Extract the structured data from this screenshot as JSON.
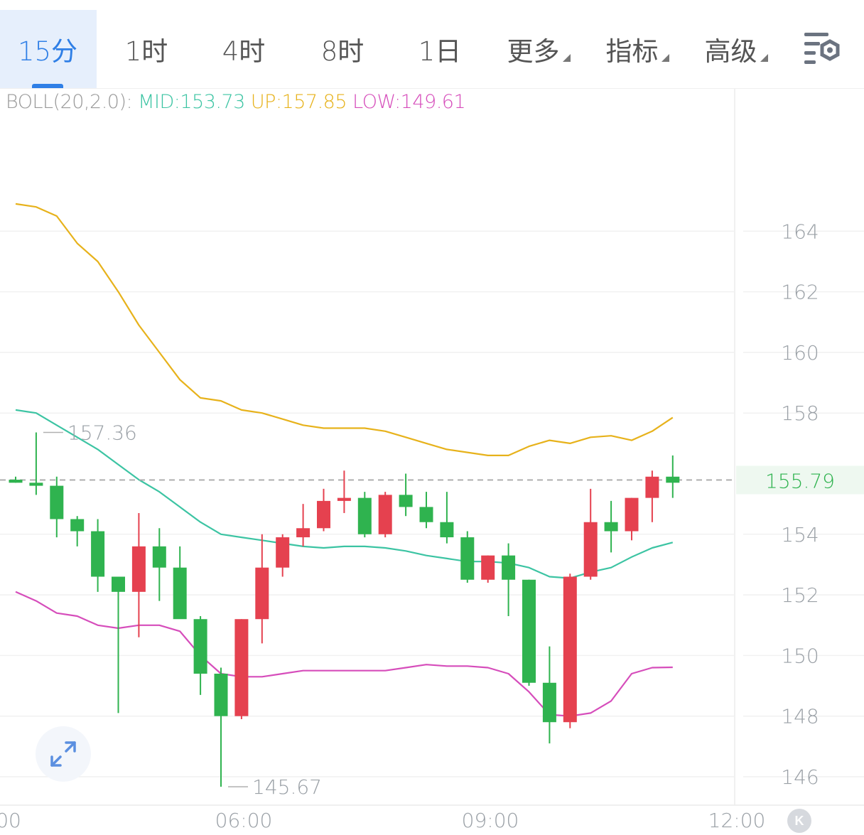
{
  "tabs": [
    {
      "label": "15分",
      "active": true,
      "has_dropdown": false
    },
    {
      "label": "1时",
      "active": false,
      "has_dropdown": false
    },
    {
      "label": "4时",
      "active": false,
      "has_dropdown": false
    },
    {
      "label": "8时",
      "active": false,
      "has_dropdown": false
    },
    {
      "label": "1日",
      "active": false,
      "has_dropdown": false
    },
    {
      "label": "更多",
      "active": false,
      "has_dropdown": true
    },
    {
      "label": "指标",
      "active": false,
      "has_dropdown": true
    },
    {
      "label": "高级",
      "active": false,
      "has_dropdown": true
    }
  ],
  "settings_icon": "chart-settings-icon",
  "legend": {
    "name": "BOLL(20,2.0):",
    "mid": "MID:153.73",
    "up": "UP:157.85",
    "low": "LOW:149.61"
  },
  "colors": {
    "up": "#e5414f",
    "down": "#2fb34f",
    "mid": "#3cc4a3",
    "upper": "#e7b21b",
    "lower": "#d64dbb",
    "active_tab": "#2f7fe6",
    "price_label": "#2fb34f",
    "price_label_bg": "#eef8f0"
  },
  "chart_data": {
    "type": "candlestick",
    "y_ticks": [
      "164",
      "162",
      "160",
      "158",
      "154",
      "152",
      "150",
      "148",
      "146"
    ],
    "ylim": [
      145.2,
      166.5
    ],
    "x_tick_labels": [
      "00",
      "06:00",
      "09:00",
      "12:00"
    ],
    "current_price": "155.79",
    "current_price_value": 155.79,
    "max_annotation": {
      "label": "157.36",
      "value": 157.36
    },
    "min_annotation": {
      "label": "145.67",
      "value": 145.67
    },
    "candles": [
      {
        "open": 155.8,
        "high": 155.9,
        "low": 155.7,
        "close": 155.7
      },
      {
        "open": 155.7,
        "high": 157.36,
        "low": 155.3,
        "close": 155.6
      },
      {
        "open": 155.6,
        "high": 155.9,
        "low": 153.9,
        "close": 154.5
      },
      {
        "open": 154.5,
        "high": 154.6,
        "low": 153.6,
        "close": 154.1
      },
      {
        "open": 154.1,
        "high": 154.5,
        "low": 152.1,
        "close": 152.6
      },
      {
        "open": 152.6,
        "high": 152.6,
        "low": 148.1,
        "close": 152.1
      },
      {
        "open": 152.1,
        "high": 154.7,
        "low": 150.6,
        "close": 153.6
      },
      {
        "open": 153.6,
        "high": 154.2,
        "low": 151.8,
        "close": 152.9
      },
      {
        "open": 152.9,
        "high": 153.6,
        "low": 151.3,
        "close": 151.2
      },
      {
        "open": 151.2,
        "high": 151.3,
        "low": 148.7,
        "close": 149.4
      },
      {
        "open": 149.4,
        "high": 149.6,
        "low": 145.67,
        "close": 148.0
      },
      {
        "open": 148.0,
        "high": 151.2,
        "low": 147.9,
        "close": 151.2
      },
      {
        "open": 151.2,
        "high": 154.0,
        "low": 150.4,
        "close": 152.9
      },
      {
        "open": 152.9,
        "high": 154.0,
        "low": 152.6,
        "close": 153.9
      },
      {
        "open": 153.9,
        "high": 155.0,
        "low": 153.6,
        "close": 154.2
      },
      {
        "open": 154.2,
        "high": 155.5,
        "low": 154.1,
        "close": 155.1
      },
      {
        "open": 155.1,
        "high": 156.1,
        "low": 154.7,
        "close": 155.2
      },
      {
        "open": 155.2,
        "high": 155.4,
        "low": 153.9,
        "close": 154.0
      },
      {
        "open": 154.0,
        "high": 155.4,
        "low": 153.9,
        "close": 155.3
      },
      {
        "open": 155.3,
        "high": 156.0,
        "low": 154.6,
        "close": 154.9
      },
      {
        "open": 154.9,
        "high": 155.4,
        "low": 154.2,
        "close": 154.4
      },
      {
        "open": 154.4,
        "high": 155.4,
        "low": 153.7,
        "close": 153.9
      },
      {
        "open": 153.9,
        "high": 154.1,
        "low": 152.4,
        "close": 152.5
      },
      {
        "open": 152.5,
        "high": 153.3,
        "low": 152.4,
        "close": 153.3
      },
      {
        "open": 153.3,
        "high": 153.7,
        "low": 151.3,
        "close": 152.5
      },
      {
        "open": 152.5,
        "high": 152.5,
        "low": 149.0,
        "close": 149.1
      },
      {
        "open": 149.1,
        "high": 150.3,
        "low": 147.1,
        "close": 147.8
      },
      {
        "open": 147.8,
        "high": 152.7,
        "low": 147.6,
        "close": 152.6
      },
      {
        "open": 152.6,
        "high": 155.5,
        "low": 152.5,
        "close": 154.4
      },
      {
        "open": 154.4,
        "high": 155.1,
        "low": 153.4,
        "close": 154.1
      },
      {
        "open": 154.1,
        "high": 155.2,
        "low": 153.8,
        "close": 155.2
      },
      {
        "open": 155.2,
        "high": 156.1,
        "low": 154.4,
        "close": 155.9
      },
      {
        "open": 155.9,
        "high": 156.6,
        "low": 155.2,
        "close": 155.7
      }
    ],
    "boll_upper": [
      164.9,
      164.8,
      164.5,
      163.6,
      163.0,
      162.0,
      160.9,
      160.0,
      159.1,
      158.5,
      158.4,
      158.1,
      158.0,
      157.8,
      157.6,
      157.5,
      157.5,
      157.5,
      157.4,
      157.2,
      157.0,
      156.8,
      156.7,
      156.6,
      156.6,
      156.9,
      157.1,
      157.0,
      157.2,
      157.25,
      157.1,
      157.4,
      157.85
    ],
    "boll_mid": [
      158.1,
      158.0,
      157.6,
      157.2,
      156.8,
      156.3,
      155.8,
      155.4,
      154.9,
      154.4,
      154.0,
      153.9,
      153.8,
      153.7,
      153.6,
      153.55,
      153.6,
      153.6,
      153.55,
      153.45,
      153.3,
      153.2,
      153.1,
      153.1,
      153.05,
      152.9,
      152.6,
      152.55,
      152.75,
      152.9,
      153.25,
      153.55,
      153.73
    ],
    "boll_lower": [
      152.1,
      151.8,
      151.4,
      151.3,
      151.0,
      150.9,
      151.0,
      151.0,
      150.8,
      150.0,
      149.4,
      149.3,
      149.3,
      149.4,
      149.5,
      149.5,
      149.5,
      149.5,
      149.5,
      149.6,
      149.7,
      149.65,
      149.65,
      149.6,
      149.4,
      148.8,
      148.05,
      148.0,
      148.1,
      148.5,
      149.4,
      149.6,
      149.61
    ],
    "grid": true
  }
}
